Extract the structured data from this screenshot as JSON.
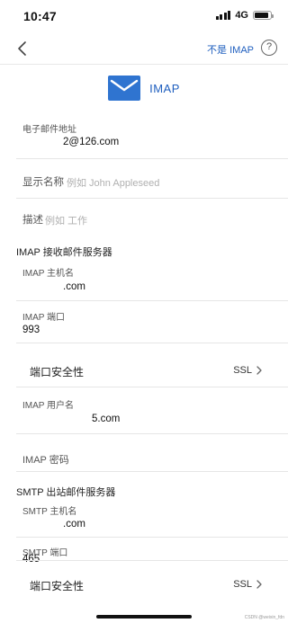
{
  "status": {
    "time": "10:47",
    "network": "4G",
    "battery_level": 0.9
  },
  "nav": {
    "not_imap": "不是 IMAP",
    "help": "?"
  },
  "header": {
    "title": "IMAP"
  },
  "email": {
    "label": "电子邮件地址",
    "value": "2@126.com"
  },
  "display_name": {
    "label": "显示名称",
    "placeholder": "例如 John Appleseed"
  },
  "description": {
    "label": "描述",
    "placeholder": "例如 工作"
  },
  "imap_section": {
    "title": "IMAP 接收邮件服务器"
  },
  "imap_host": {
    "label": "IMAP 主机名",
    "value": ".com"
  },
  "imap_port": {
    "label": "IMAP 端口",
    "value": "993"
  },
  "imap_security": {
    "label": "端口安全性",
    "value": "SSL"
  },
  "imap_user": {
    "label": "IMAP 用户名",
    "value": "5.com"
  },
  "imap_password": {
    "label": "IMAP 密码"
  },
  "smtp_section": {
    "title": "SMTP 出站邮件服务器"
  },
  "smtp_host": {
    "label": "SMTP 主机名",
    "value": ".com"
  },
  "smtp_port": {
    "label": "SMTP 端口",
    "value": "465"
  },
  "smtp_security": {
    "label": "端口安全性",
    "value": "SSL"
  },
  "watermark": "CSDN @weixin_fdn"
}
